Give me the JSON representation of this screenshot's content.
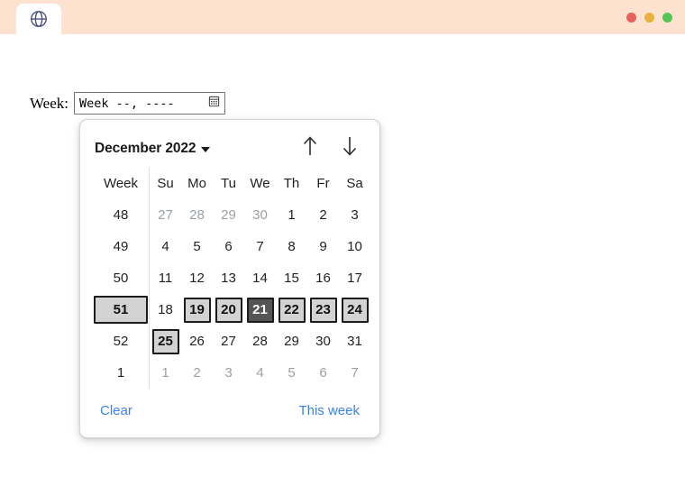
{
  "browser": {
    "tab_icon": "globe-icon",
    "window_buttons": [
      {
        "name": "close",
        "color": "#e8615a"
      },
      {
        "name": "minimize",
        "color": "#e8b23c"
      },
      {
        "name": "maximize",
        "color": "#53c653"
      }
    ],
    "chrome_color": "#fde3cf"
  },
  "form": {
    "label": "Week:",
    "input_value": "Week --, ----",
    "picker_icon": "calendar-icon"
  },
  "calendar": {
    "month_year": "December 2022",
    "dropdown_icon": "chevron-down-icon",
    "prev_icon": "arrow-up-icon",
    "next_icon": "arrow-down-icon",
    "week_column_header": "Week",
    "day_headers": [
      "Su",
      "Mo",
      "Tu",
      "We",
      "Th",
      "Fr",
      "Sa"
    ],
    "rows": [
      {
        "week": "48",
        "week_selected": false,
        "days": [
          {
            "n": "27",
            "outside": true,
            "state": "none"
          },
          {
            "n": "28",
            "outside": true,
            "state": "none"
          },
          {
            "n": "29",
            "outside": true,
            "state": "none"
          },
          {
            "n": "30",
            "outside": true,
            "state": "none"
          },
          {
            "n": "1",
            "outside": false,
            "state": "none"
          },
          {
            "n": "2",
            "outside": false,
            "state": "none"
          },
          {
            "n": "3",
            "outside": false,
            "state": "none"
          }
        ]
      },
      {
        "week": "49",
        "week_selected": false,
        "days": [
          {
            "n": "4",
            "outside": false,
            "state": "none"
          },
          {
            "n": "5",
            "outside": false,
            "state": "none"
          },
          {
            "n": "6",
            "outside": false,
            "state": "none"
          },
          {
            "n": "7",
            "outside": false,
            "state": "none"
          },
          {
            "n": "8",
            "outside": false,
            "state": "none"
          },
          {
            "n": "9",
            "outside": false,
            "state": "none"
          },
          {
            "n": "10",
            "outside": false,
            "state": "none"
          }
        ]
      },
      {
        "week": "50",
        "week_selected": false,
        "days": [
          {
            "n": "11",
            "outside": false,
            "state": "none"
          },
          {
            "n": "12",
            "outside": false,
            "state": "none"
          },
          {
            "n": "13",
            "outside": false,
            "state": "none"
          },
          {
            "n": "14",
            "outside": false,
            "state": "none"
          },
          {
            "n": "15",
            "outside": false,
            "state": "none"
          },
          {
            "n": "16",
            "outside": false,
            "state": "none"
          },
          {
            "n": "17",
            "outside": false,
            "state": "none"
          }
        ]
      },
      {
        "week": "51",
        "week_selected": true,
        "days": [
          {
            "n": "18",
            "outside": false,
            "state": "none"
          },
          {
            "n": "19",
            "outside": false,
            "state": "selected"
          },
          {
            "n": "20",
            "outside": false,
            "state": "selected"
          },
          {
            "n": "21",
            "outside": false,
            "state": "today"
          },
          {
            "n": "22",
            "outside": false,
            "state": "selected"
          },
          {
            "n": "23",
            "outside": false,
            "state": "selected"
          },
          {
            "n": "24",
            "outside": false,
            "state": "selected"
          }
        ]
      },
      {
        "week": "52",
        "week_selected": false,
        "days": [
          {
            "n": "25",
            "outside": false,
            "state": "selected"
          },
          {
            "n": "26",
            "outside": false,
            "state": "none"
          },
          {
            "n": "27",
            "outside": false,
            "state": "none"
          },
          {
            "n": "28",
            "outside": false,
            "state": "none"
          },
          {
            "n": "29",
            "outside": false,
            "state": "none"
          },
          {
            "n": "30",
            "outside": false,
            "state": "none"
          },
          {
            "n": "31",
            "outside": false,
            "state": "none"
          }
        ]
      },
      {
        "week": "1",
        "week_selected": false,
        "days": [
          {
            "n": "1",
            "outside": true,
            "state": "none"
          },
          {
            "n": "2",
            "outside": true,
            "state": "none"
          },
          {
            "n": "3",
            "outside": true,
            "state": "none"
          },
          {
            "n": "4",
            "outside": true,
            "state": "none"
          },
          {
            "n": "5",
            "outside": true,
            "state": "none"
          },
          {
            "n": "6",
            "outside": true,
            "state": "none"
          },
          {
            "n": "7",
            "outside": true,
            "state": "none"
          }
        ]
      }
    ],
    "clear_label": "Clear",
    "this_week_label": "This week",
    "link_color": "#3b82e8",
    "selected_bg": "#d3d3d3",
    "today_bg": "#555555"
  }
}
